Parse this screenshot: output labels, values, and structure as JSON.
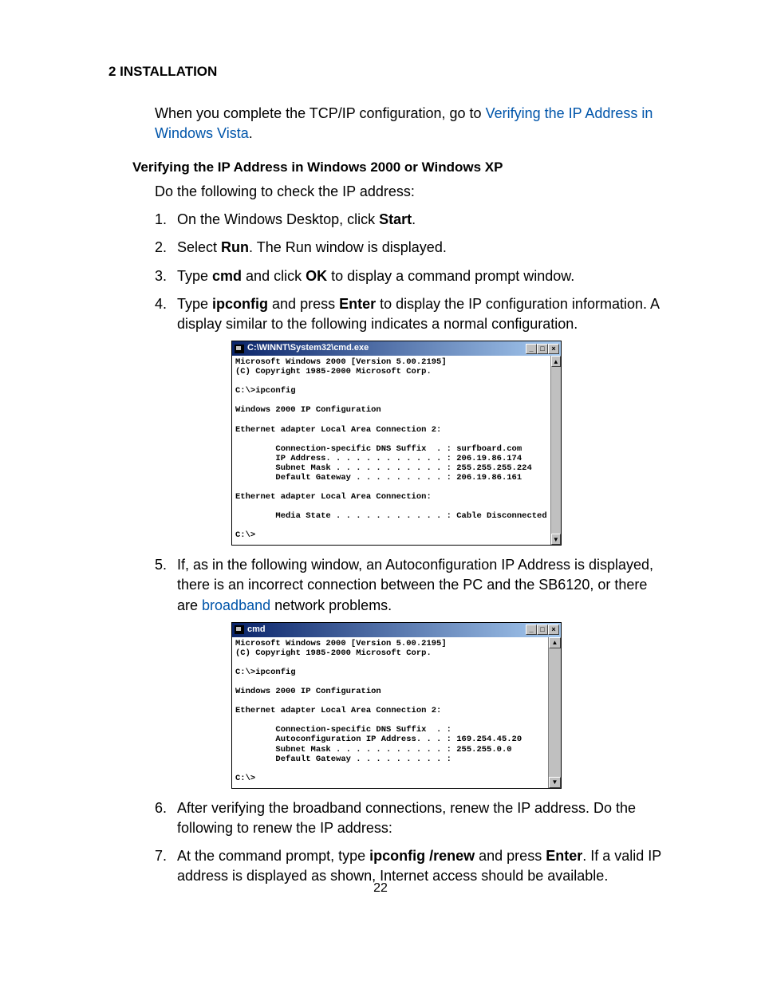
{
  "header": {
    "section": "2 INSTALLATION"
  },
  "intro": {
    "pre": "When you complete the TCP/IP configuration, go to ",
    "link": "Verifying the IP Address in Windows Vista",
    "post": "."
  },
  "heading": "Verifying the IP Address in Windows 2000 or Windows XP",
  "lead": "Do the following to check the IP address:",
  "s1": {
    "num": "1.",
    "t1": "On the Windows Desktop, click ",
    "b1": "Start",
    "t2": "."
  },
  "s2": {
    "num": "2.",
    "t1": "Select ",
    "b1": "Run",
    "t2": ". The Run window is displayed."
  },
  "s3": {
    "num": "3.",
    "t1": "Type ",
    "b1": "cmd",
    "t2": " and click ",
    "b2": "OK",
    "t3": " to display a command prompt window."
  },
  "s4": {
    "num": "4.",
    "t1": "Type ",
    "b1": "ipconfig",
    "t2": " and press ",
    "b2": "Enter",
    "t3": " to display the IP configuration information. A display similar to the following indicates a normal configuration."
  },
  "s5": {
    "num": "5.",
    "t1": "If, as in the following window, an Autoconfiguration IP Address is displayed, there is an incorrect connection between the PC and the SB6120, or there are ",
    "link": "broadband",
    "t2": " network problems."
  },
  "s6": {
    "num": "6.",
    "t1": "After verifying the broadband connections, renew the IP address. Do the following to renew the IP address:"
  },
  "s7": {
    "num": "7.",
    "t1": "At the command prompt, type ",
    "b1": "ipconfig /renew",
    "t2": " and press ",
    "b2": "Enter",
    "t3": ". If a valid IP address is displayed as shown, Internet access should be available."
  },
  "cmd1": {
    "title": "C:\\WINNT\\System32\\cmd.exe",
    "buttons": {
      "min": "_",
      "max": "□",
      "close": "×"
    },
    "body": "Microsoft Windows 2000 [Version 5.00.2195]\n(C) Copyright 1985-2000 Microsoft Corp.\n\nC:\\>ipconfig\n\nWindows 2000 IP Configuration\n\nEthernet adapter Local Area Connection 2:\n\n        Connection-specific DNS Suffix  . : surfboard.com\n        IP Address. . . . . . . . . . . . : 206.19.86.174\n        Subnet Mask . . . . . . . . . . . : 255.255.255.224\n        Default Gateway . . . . . . . . . : 206.19.86.161\n\nEthernet adapter Local Area Connection:\n\n        Media State . . . . . . . . . . . : Cable Disconnected\n\nC:\\>\n"
  },
  "cmd2": {
    "title": "cmd",
    "buttons": {
      "min": "_",
      "max": "□",
      "close": "×"
    },
    "body": "Microsoft Windows 2000 [Version 5.00.2195]\n(C) Copyright 1985-2000 Microsoft Corp.\n\nC:\\>ipconfig\n\nWindows 2000 IP Configuration\n\nEthernet adapter Local Area Connection 2:\n\n        Connection-specific DNS Suffix  . :\n        Autoconfiguration IP Address. . . : 169.254.45.20\n        Subnet Mask . . . . . . . . . . . : 255.255.0.0\n        Default Gateway . . . . . . . . . :\n\nC:\\>\n"
  },
  "scroll": {
    "up": "▲",
    "down": "▼"
  },
  "page_number": "22"
}
